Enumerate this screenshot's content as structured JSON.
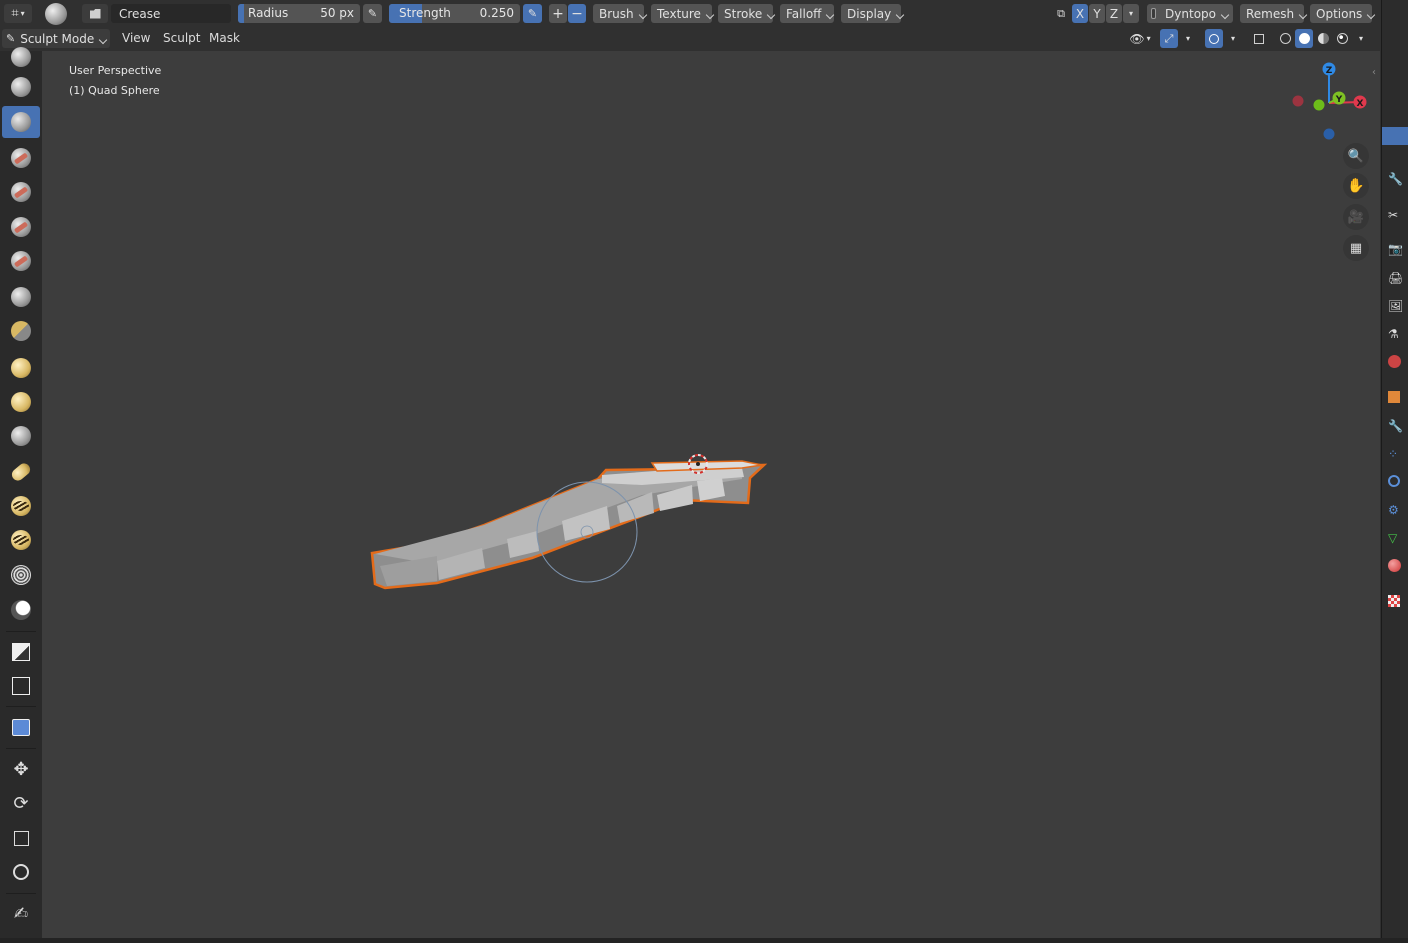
{
  "header": {
    "brush_name": "Crease",
    "radius": {
      "label": "Radius",
      "value": "50 px"
    },
    "strength": {
      "label": "Strength",
      "value": "0.250",
      "fraction": 0.25
    },
    "add_label": "+",
    "subtract_label": "−",
    "menus": [
      "Brush",
      "Texture",
      "Stroke",
      "Falloff",
      "Display"
    ],
    "axes": [
      "X",
      "Y",
      "Z"
    ],
    "dyntopo": "Dyntopo",
    "remesh": "Remesh",
    "options": "Options"
  },
  "subheader": {
    "mode": "Sculpt Mode",
    "menus": [
      "View",
      "Sculpt",
      "Mask"
    ]
  },
  "viewport": {
    "perspective": "User Perspective",
    "object": "(1) Quad Sphere",
    "gizmo": {
      "x": "X",
      "y": "Y",
      "z": "Z"
    }
  },
  "colors": {
    "accent": "#4772b3",
    "selection_outline": "#e36b1a",
    "axis_x": "#e0394d",
    "axis_y": "#7ec123",
    "axis_z": "#2f8ae6"
  },
  "toolbar": {
    "tools": [
      "draw-brush-icon",
      "draw-sharp-brush-icon",
      "clay-brush-icon",
      "clay-strips-brush-icon",
      "clay-thumb-brush-icon",
      "layer-brush-icon",
      "inflate-brush-icon",
      "blob-brush-icon",
      "crease-brush-icon",
      "smooth-brush-icon",
      "flatten-brush-icon",
      "fill-brush-icon",
      "scrape-brush-icon",
      "multiplane-scrape-brush-icon",
      "pinch-brush-icon",
      "grab-brush-icon",
      "snake-hook-brush-icon",
      "thumb-brush-icon",
      "pose-brush-icon",
      "nudge-brush-icon",
      "rotate-brush-icon",
      "simplify-brush-icon",
      "mask-brush-icon",
      "box-mask-icon",
      "box-hide-icon",
      "mesh-filter-icon",
      "cloth-filter-icon",
      "move-icon",
      "rotate-icon",
      "scale-icon",
      "transform-icon",
      "annotate-icon"
    ],
    "active": "clay-brush-icon"
  }
}
